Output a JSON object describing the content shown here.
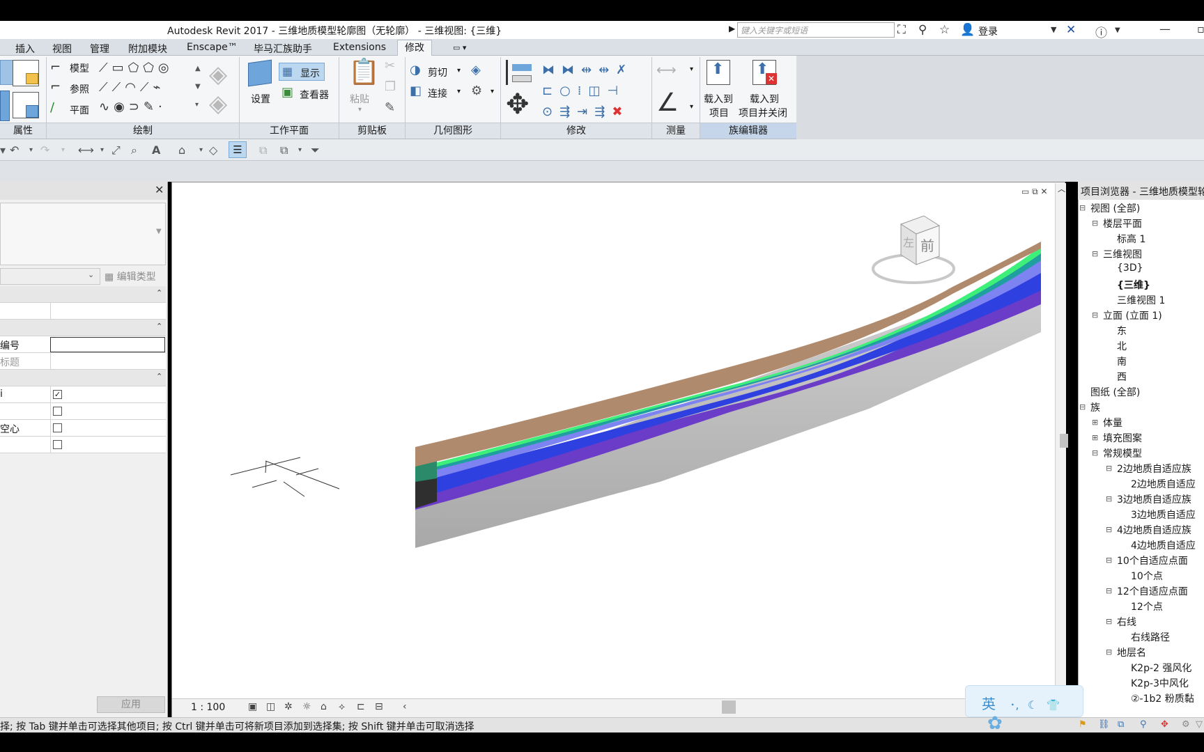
{
  "titlebar": {
    "title": "Autodesk Revit 2017 -     三维地质模型轮廓图（无轮廓） - 三维视图: {三维}",
    "search_placeholder": "键入关键字或短语",
    "login": "登录"
  },
  "tabs": [
    "插入",
    "视图",
    "管理",
    "附加模块",
    "Enscape™",
    "毕马汇族助手",
    "Extensions",
    "修改"
  ],
  "ribbon": {
    "draw": {
      "model": "模型",
      "reference": "参照",
      "plane": "平面"
    },
    "workplane": {
      "set": "设置",
      "show": "显示",
      "viewer": "查看器"
    },
    "clipboard": {
      "paste": "粘贴"
    },
    "geometry": {
      "cut": "剪切",
      "join": "连接"
    },
    "family": {
      "load_to_project": "载入到\n项目",
      "load_to_project_line1": "载入到",
      "load_to_project_line2": "项目",
      "load_close_line1": "载入到",
      "load_close_line2": "项目并关闭"
    },
    "panels": {
      "properties": "属性",
      "draw": "绘制",
      "workplane": "工作平面",
      "clipboard": "剪贴板",
      "geometry": "几何图形",
      "modify": "修改",
      "measure": "测量",
      "family_editor": "族编辑器"
    }
  },
  "properties": {
    "edit_type": "编辑类型",
    "rows": [
      {
        "label": "编号",
        "kind": "input"
      },
      {
        "label": "标题",
        "kind": "grey"
      }
    ],
    "checkbox_rows": [
      {
        "label": "i",
        "checked": true
      },
      {
        "label": "",
        "checked": false
      },
      {
        "label": "空心",
        "checked": false
      },
      {
        "label": "",
        "checked": false
      }
    ],
    "apply": "应用"
  },
  "viewport": {
    "scale": "1 : 100",
    "viewcube_front": "前",
    "viewcube_left": "左"
  },
  "browser": {
    "title": "项目浏览器 - 三维地质模型轮廓图",
    "items": [
      {
        "label": "视图 (全部)",
        "level": 0,
        "exp": "−"
      },
      {
        "label": "楼层平面",
        "level": 1,
        "exp": "−"
      },
      {
        "label": "标高 1",
        "level": 2,
        "exp": ""
      },
      {
        "label": "三维视图",
        "level": 1,
        "exp": "−"
      },
      {
        "label": "{3D}",
        "level": 2,
        "exp": ""
      },
      {
        "label": "{三维}",
        "level": 2,
        "exp": "",
        "bold": true
      },
      {
        "label": "三维视图 1",
        "level": 2,
        "exp": ""
      },
      {
        "label": "立面 (立面 1)",
        "level": 1,
        "exp": "−"
      },
      {
        "label": "东",
        "level": 2,
        "exp": ""
      },
      {
        "label": "北",
        "level": 2,
        "exp": ""
      },
      {
        "label": "南",
        "level": 2,
        "exp": ""
      },
      {
        "label": "西",
        "level": 2,
        "exp": ""
      },
      {
        "label": "图纸 (全部)",
        "level": 0,
        "exp": ""
      },
      {
        "label": "族",
        "level": 0,
        "exp": "−"
      },
      {
        "label": "体量",
        "level": 1,
        "exp": "+"
      },
      {
        "label": "填充图案",
        "level": 1,
        "exp": "+"
      },
      {
        "label": "常规模型",
        "level": 1,
        "exp": "−"
      },
      {
        "label": "2边地质自适应族",
        "level": 2,
        "exp": "−"
      },
      {
        "label": "2边地质自适应",
        "level": 3,
        "exp": ""
      },
      {
        "label": "3边地质自适应族",
        "level": 2,
        "exp": "−"
      },
      {
        "label": "3边地质自适应",
        "level": 3,
        "exp": ""
      },
      {
        "label": "4边地质自适应族",
        "level": 2,
        "exp": "−"
      },
      {
        "label": "4边地质自适应",
        "level": 3,
        "exp": ""
      },
      {
        "label": "10个自适应点面",
        "level": 2,
        "exp": "−"
      },
      {
        "label": "10个点",
        "level": 3,
        "exp": ""
      },
      {
        "label": "12个自适应点面",
        "level": 2,
        "exp": "−"
      },
      {
        "label": "12个点",
        "level": 3,
        "exp": ""
      },
      {
        "label": "右线",
        "level": 2,
        "exp": "−"
      },
      {
        "label": "右线路径",
        "level": 3,
        "exp": ""
      },
      {
        "label": "地层名",
        "level": 2,
        "exp": "−"
      },
      {
        "label": "K2p-2 强风化",
        "level": 3,
        "exp": ""
      },
      {
        "label": "K2p-3中风化",
        "level": 3,
        "exp": ""
      },
      {
        "label": "②-1b2 粉质黏",
        "level": 3,
        "exp": ""
      }
    ]
  },
  "statusbar": {
    "text": "择; 按 Tab 键并单击可选择其他项目; 按 Ctrl 键并单击可将新项目添加到选择集; 按 Shift 键并单击可取消选择"
  },
  "ime": {
    "label": "英"
  }
}
